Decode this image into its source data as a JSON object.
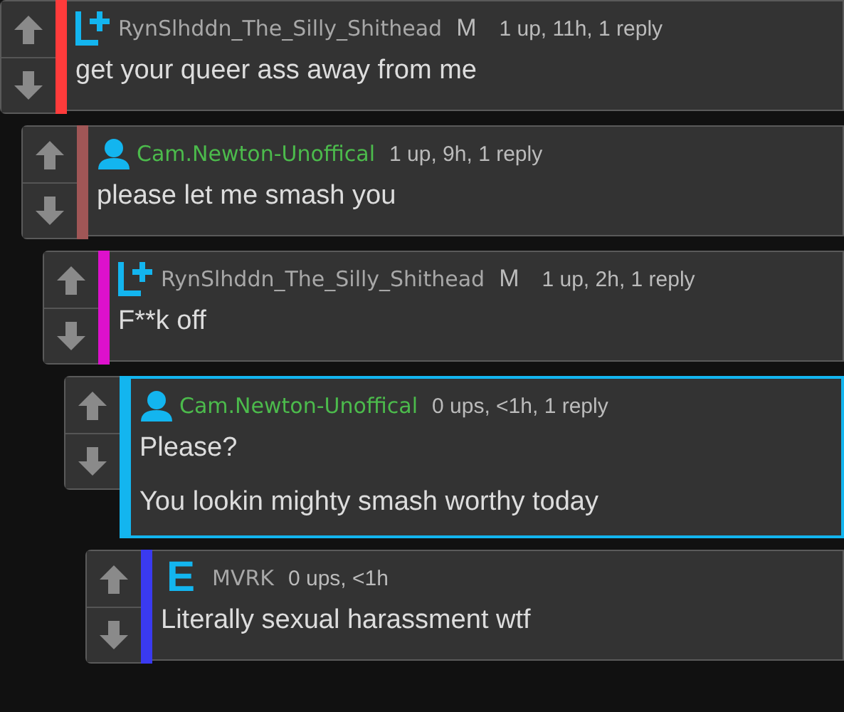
{
  "comments": [
    {
      "badge": {
        "kind": "plus"
      },
      "author": "RynSlhddn_The_Silly_Shithead",
      "author_highlighted": false,
      "gender": "M",
      "meta": "1 up, 11h, 1 reply",
      "color": "#ff3b3b",
      "highlighted": false,
      "body": [
        "get your queer ass away from me"
      ],
      "children": [
        {
          "badge": {
            "kind": "person"
          },
          "author": "Cam.Newton-Unoffical",
          "author_highlighted": true,
          "meta": "1 up, 9h, 1 reply",
          "color": "#a05656",
          "highlighted": false,
          "body": [
            "please let me smash you"
          ],
          "children": [
            {
              "badge": {
                "kind": "plus"
              },
              "author": "RynSlhddn_The_Silly_Shithead",
              "author_highlighted": false,
              "gender": "M",
              "meta": "1 up, 2h, 1 reply",
              "color": "#dd11cc",
              "highlighted": false,
              "body": [
                "F**k off"
              ],
              "children": [
                {
                  "badge": {
                    "kind": "person"
                  },
                  "author": "Cam.Newton-Unoffical",
                  "author_highlighted": true,
                  "meta": "0 ups, <1h, 1 reply",
                  "color": "#13b5ef",
                  "highlighted": true,
                  "body": [
                    "Please?",
                    "You lookin mighty smash worthy today"
                  ],
                  "children": [
                    {
                      "badge": {
                        "kind": "letter",
                        "text": "E"
                      },
                      "author": "MVRK",
                      "author_highlighted": false,
                      "meta": "0 ups, <1h",
                      "color": "#3a3af0",
                      "highlighted": false,
                      "body": [
                        "Literally sexual harassment wtf"
                      ]
                    }
                  ]
                }
              ]
            }
          ]
        }
      ]
    }
  ]
}
